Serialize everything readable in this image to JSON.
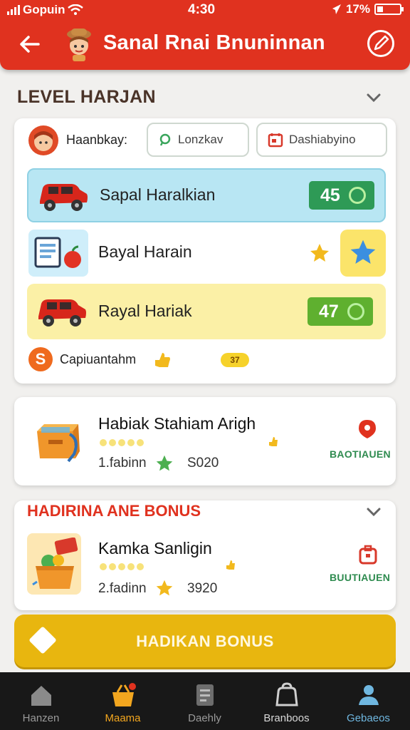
{
  "status": {
    "carrier": "Gopuin",
    "time": "4:30",
    "battery": "17%"
  },
  "header": {
    "title": "Sanal Rnai Bnuninnan"
  },
  "section1": {
    "title": "LEVEL HARJAN",
    "filter_label": "Haanbkay:",
    "dropdown1": "Lonzkav",
    "dropdown2": "Dashiabyino",
    "items": [
      {
        "name": "Sapal Haralkian",
        "score": "45",
        "bg": "#b8e6f3"
      },
      {
        "name": "Bayal Harain",
        "bg": "#ffffff"
      },
      {
        "name": "Rayal Hariak",
        "score": "47",
        "bg": "#fbf0a6"
      }
    ],
    "captain_label": "Capiuantahm",
    "captain_pill": "37"
  },
  "quest1": {
    "name": "Habiak Stahiam Arigh",
    "meta_left": "1.fabinn",
    "meta_right": "S020",
    "tag": "BAOTIAUEN"
  },
  "section2": {
    "title": "HADIRINA ANE BONUS"
  },
  "quest2": {
    "name": "Kamka Sanligin",
    "meta_left": "2.fadinn",
    "meta_right": "3920",
    "tag": "BUUTIAUEN"
  },
  "cta": {
    "label": "HADIKAN BONUS"
  },
  "nav": [
    {
      "label": "Hanzen",
      "color": "#9a9a9a"
    },
    {
      "label": "Maama",
      "color": "#f2a61f"
    },
    {
      "label": "Daehly",
      "color": "#9a9a9a"
    },
    {
      "label": "Branboos",
      "color": "#d8d8d8"
    },
    {
      "label": "Gebaeos",
      "color": "#6fb7e0"
    }
  ],
  "colors": {
    "header": "#e0321f",
    "accent": "#e8b60f",
    "score_blue": "#2e9a56",
    "score_green": "#5fb02f"
  }
}
